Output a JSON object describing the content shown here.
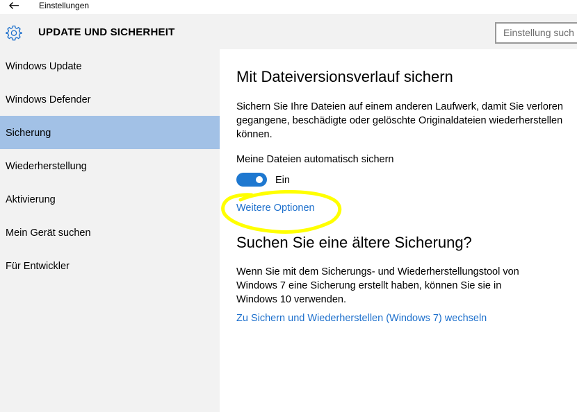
{
  "window": {
    "title": "Einstellungen",
    "back_icon": "back-arrow-icon"
  },
  "header": {
    "icon": "gear-icon",
    "title": "UPDATE UND SICHERHEIT",
    "search_placeholder": "Einstellung such"
  },
  "sidebar": {
    "items": [
      {
        "label": "Windows Update",
        "selected": false
      },
      {
        "label": "Windows Defender",
        "selected": false
      },
      {
        "label": "Sicherung",
        "selected": true
      },
      {
        "label": "Wiederherstellung",
        "selected": false
      },
      {
        "label": "Aktivierung",
        "selected": false
      },
      {
        "label": "Mein Gerät suchen",
        "selected": false
      },
      {
        "label": "Für Entwickler",
        "selected": false
      }
    ]
  },
  "main": {
    "section1": {
      "heading": "Mit Dateiversionsverlauf sichern",
      "description": "Sichern Sie Ihre Dateien auf einem anderen Laufwerk, damit Sie verloren gegangene, beschädigte oder gelöschte Originaldateien wiederherstellen können.",
      "auto_backup_label": "Meine Dateien automatisch sichern",
      "toggle_state": "Ein",
      "toggle_on": true,
      "more_options_link": "Weitere Optionen"
    },
    "section2": {
      "heading": "Suchen Sie eine ältere Sicherung?",
      "description": "Wenn Sie mit dem Sicherungs- und Wiederherstellungstool von Windows 7 eine Sicherung erstellt haben, können Sie sie in Windows 10 verwenden.",
      "switch_link": "Zu Sichern und Wiederherstellen (Windows 7) wechseln"
    }
  },
  "colors": {
    "accent": "#1e78d0",
    "link": "#1c6fcc",
    "selected_nav": "#a2c1e6",
    "sidebar_bg": "#f2f2f2",
    "annotation": "#ffff00"
  }
}
